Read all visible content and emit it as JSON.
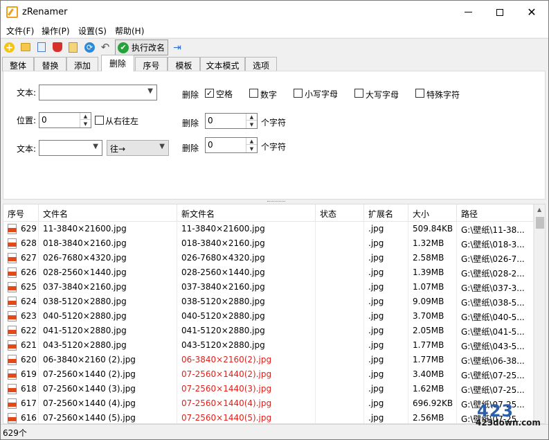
{
  "window": {
    "title": "zRenamer"
  },
  "menu": [
    "文件(F)",
    "操作(P)",
    "设置(S)",
    "帮助(H)"
  ],
  "toolbar": {
    "execute_label": "执行改名"
  },
  "tabs": [
    "整体",
    "替换",
    "添加",
    "删除",
    "序号",
    "模板",
    "文本模式",
    "选项"
  ],
  "active_tab": "删除",
  "panel": {
    "text_label": "文本:",
    "position_label": "位置:",
    "position_value": "0",
    "from_right_label": "从右往左",
    "text2_label": "文本:",
    "direction_value": "往→",
    "delete_label": "删除",
    "options": [
      "空格",
      "数字",
      "小写字母",
      "大写字母",
      "特殊字符"
    ],
    "checked": [
      true,
      false,
      false,
      false,
      false
    ],
    "delete2_value": "0",
    "delete3_value": "0",
    "chars_label": "个字符"
  },
  "columns": [
    "序号",
    "文件名",
    "新文件名",
    "状态",
    "扩展名",
    "大小",
    "路径"
  ],
  "rows": [
    {
      "seq": "629",
      "name": "11-3840×21600.jpg",
      "new": "11-3840×21600.jpg",
      "ext": ".jpg",
      "size": "509.84KB",
      "path": "G:\\壁纸\\11-38...",
      "changed": false
    },
    {
      "seq": "628",
      "name": "018-3840×2160.jpg",
      "new": "018-3840×2160.jpg",
      "ext": ".jpg",
      "size": "1.32MB",
      "path": "G:\\壁纸\\018-3...",
      "changed": false
    },
    {
      "seq": "627",
      "name": "026-7680×4320.jpg",
      "new": "026-7680×4320.jpg",
      "ext": ".jpg",
      "size": "2.58MB",
      "path": "G:\\壁纸\\026-7...",
      "changed": false
    },
    {
      "seq": "626",
      "name": "028-2560×1440.jpg",
      "new": "028-2560×1440.jpg",
      "ext": ".jpg",
      "size": "1.39MB",
      "path": "G:\\壁纸\\028-2...",
      "changed": false
    },
    {
      "seq": "625",
      "name": "037-3840×2160.jpg",
      "new": "037-3840×2160.jpg",
      "ext": ".jpg",
      "size": "1.07MB",
      "path": "G:\\壁纸\\037-3...",
      "changed": false
    },
    {
      "seq": "624",
      "name": "038-5120×2880.jpg",
      "new": "038-5120×2880.jpg",
      "ext": ".jpg",
      "size": "9.09MB",
      "path": "G:\\壁纸\\038-5...",
      "changed": false
    },
    {
      "seq": "623",
      "name": "040-5120×2880.jpg",
      "new": "040-5120×2880.jpg",
      "ext": ".jpg",
      "size": "3.70MB",
      "path": "G:\\壁纸\\040-5...",
      "changed": false
    },
    {
      "seq": "622",
      "name": "041-5120×2880.jpg",
      "new": "041-5120×2880.jpg",
      "ext": ".jpg",
      "size": "2.05MB",
      "path": "G:\\壁纸\\041-5...",
      "changed": false
    },
    {
      "seq": "621",
      "name": "043-5120×2880.jpg",
      "new": "043-5120×2880.jpg",
      "ext": ".jpg",
      "size": "1.77MB",
      "path": "G:\\壁纸\\043-5...",
      "changed": false
    },
    {
      "seq": "620",
      "name": "06-3840×2160 (2).jpg",
      "new": "06-3840×2160(2).jpg",
      "ext": ".jpg",
      "size": "1.77MB",
      "path": "G:\\壁纸\\06-38...",
      "changed": true
    },
    {
      "seq": "619",
      "name": "07-2560×1440 (2).jpg",
      "new": "07-2560×1440(2).jpg",
      "ext": ".jpg",
      "size": "3.40MB",
      "path": "G:\\壁纸\\07-25...",
      "changed": true
    },
    {
      "seq": "618",
      "name": "07-2560×1440 (3).jpg",
      "new": "07-2560×1440(3).jpg",
      "ext": ".jpg",
      "size": "1.62MB",
      "path": "G:\\壁纸\\07-25...",
      "changed": true
    },
    {
      "seq": "617",
      "name": "07-2560×1440 (4).jpg",
      "new": "07-2560×1440(4).jpg",
      "ext": ".jpg",
      "size": "696.92KB",
      "path": "G:\\壁纸\\07-25...",
      "changed": true
    },
    {
      "seq": "616",
      "name": "07-2560×1440 (5).jpg",
      "new": "07-2560×1440(5).jpg",
      "ext": ".jpg",
      "size": "2.56MB",
      "path": "G:\\壁纸\\07-25...",
      "changed": true
    }
  ],
  "status": {
    "count": "629个"
  },
  "watermark": {
    "logo": "423",
    "site": "423down.com"
  },
  "colors": {
    "changed_text": "#e0201a",
    "exec_icon": "#25a23a",
    "accent": "#2a6fd1"
  }
}
